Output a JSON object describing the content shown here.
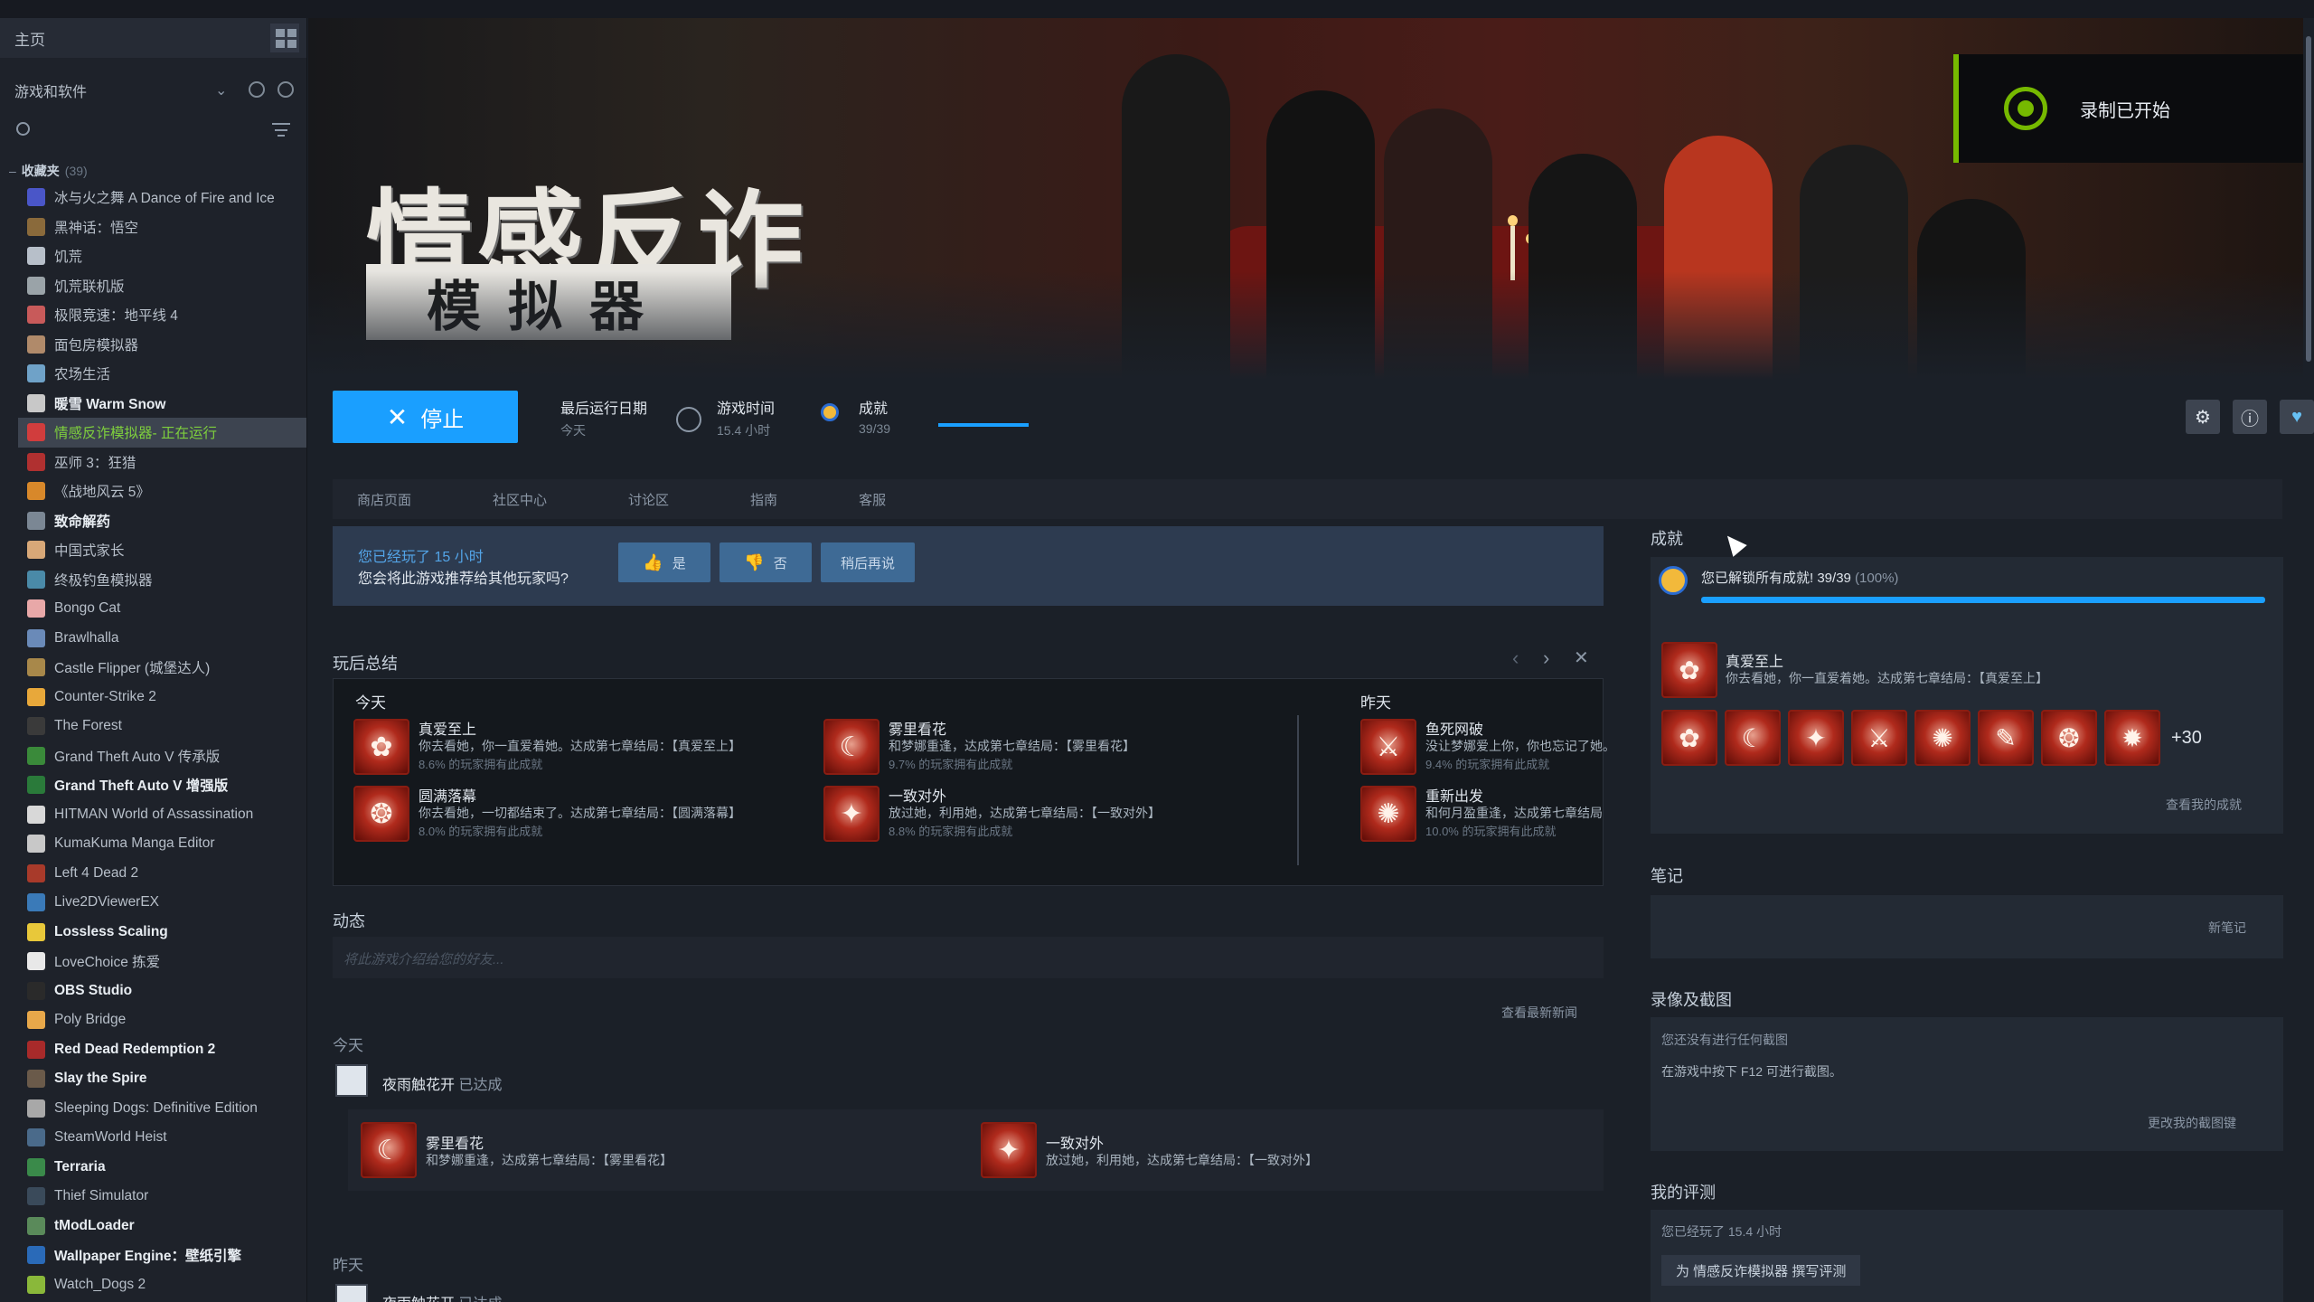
{
  "sidebar": {
    "home_label": "主页",
    "filter_label": "游戏和软件",
    "category_label": "收藏夹",
    "category_count": "(39)",
    "items": [
      {
        "label": "冰与火之舞 A Dance of Fire and Ice",
        "color": "#4a56c8",
        "bold": false
      },
      {
        "label": "黑神话：悟空",
        "color": "#8a6a3b",
        "bold": false
      },
      {
        "label": "饥荒",
        "color": "#b7bfc9",
        "bold": false
      },
      {
        "label": "饥荒联机版",
        "color": "#9aa3a8",
        "bold": false
      },
      {
        "label": "极限竞速：地平线 4",
        "color": "#c85a5a",
        "bold": false
      },
      {
        "label": "面包房模拟器",
        "color": "#b08a6a",
        "bold": false
      },
      {
        "label": "农场生活",
        "color": "#6fa2c8",
        "bold": false
      },
      {
        "label": "暖雪 Warm Snow",
        "color": "#c8c8c8",
        "bold": true
      },
      {
        "label": "情感反诈模拟器",
        "status": " - 正在运行",
        "color": "#d13d3d",
        "bold": false,
        "active": true
      },
      {
        "label": "巫师 3：狂猎",
        "color": "#b03030",
        "bold": false
      },
      {
        "label": "《战地风云 5》",
        "color": "#d8882a",
        "bold": false
      },
      {
        "label": "致命解药",
        "color": "#7b8794",
        "bold": true
      },
      {
        "label": "中国式家长",
        "color": "#d8a878",
        "bold": false
      },
      {
        "label": "终极钓鱼模拟器",
        "color": "#4a8aa8",
        "bold": false
      },
      {
        "label": "Bongo Cat",
        "color": "#e8a8a8",
        "bold": false
      },
      {
        "label": "Brawlhalla",
        "color": "#6a8ab8",
        "bold": false
      },
      {
        "label": "Castle Flipper (城堡达人)",
        "color": "#a8884a",
        "bold": false
      },
      {
        "label": "Counter-Strike 2",
        "color": "#e8a83a",
        "bold": false
      },
      {
        "label": "The Forest",
        "color": "#3a3a3a",
        "bold": false
      },
      {
        "label": "Grand Theft Auto V 传承版",
        "color": "#3a8a3a",
        "bold": false
      },
      {
        "label": "Grand Theft Auto V 增强版",
        "color": "#2a7a3a",
        "bold": true
      },
      {
        "label": "HITMAN World of Assassination",
        "color": "#d8d8d8",
        "bold": false
      },
      {
        "label": "KumaKuma Manga Editor",
        "color": "#c8c8c8",
        "bold": false
      },
      {
        "label": "Left 4 Dead 2",
        "color": "#a83a2a",
        "bold": false
      },
      {
        "label": "Live2DViewerEX",
        "color": "#3a7ab8",
        "bold": false
      },
      {
        "label": "Lossless Scaling",
        "color": "#e8c83a",
        "bold": true
      },
      {
        "label": "LoveChoice 拣爱",
        "color": "#e8e8e8",
        "bold": false
      },
      {
        "label": "OBS Studio",
        "color": "#2a2a2a",
        "bold": true
      },
      {
        "label": "Poly Bridge",
        "color": "#e8a84a",
        "bold": false
      },
      {
        "label": "Red Dead Redemption 2",
        "color": "#a82a2a",
        "bold": true
      },
      {
        "label": "Slay the Spire",
        "color": "#6a5a4a",
        "bold": true
      },
      {
        "label": "Sleeping Dogs: Definitive Edition",
        "color": "#a8a8a8",
        "bold": false
      },
      {
        "label": "SteamWorld Heist",
        "color": "#4a6a8a",
        "bold": false
      },
      {
        "label": "Terraria",
        "color": "#3a8a4a",
        "bold": true
      },
      {
        "label": "Thief Simulator",
        "color": "#3a4a5a",
        "bold": false
      },
      {
        "label": "tModLoader",
        "color": "#5a8a5a",
        "bold": true
      },
      {
        "label": "Wallpaper Engine：壁纸引擎",
        "color": "#2a6ab8",
        "bold": true
      },
      {
        "label": "Watch_Dogs 2",
        "color": "#8ab83a",
        "bold": false
      }
    ]
  },
  "hero": {
    "title": "情感反诈",
    "subtitle": "模拟器"
  },
  "toast": {
    "text": "录制已开始"
  },
  "actionbar": {
    "stop_label": "停止",
    "last_run_label": "最后运行日期",
    "last_run_value": "今天",
    "playtime_label": "游戏时间",
    "playtime_value": "15.4 小时",
    "achievements_label": "成就",
    "achievements_value": "39/39",
    "achievements_fraction": 1.0
  },
  "tabs": [
    "商店页面",
    "社区中心",
    "讨论区",
    "指南",
    "客服"
  ],
  "recommend": {
    "line1": "您已经玩了 15 小时",
    "line2": "您会将此游戏推荐给其他玩家吗?",
    "yes": "是",
    "no": "否",
    "later": "稍后再说"
  },
  "summary": {
    "title": "玩后总结",
    "today": "今天",
    "yesterday": "昨天",
    "today_items": [
      {
        "name": "真爱至上",
        "desc": "你去看她，你一直爱着她。达成第七章结局：【真爱至上】",
        "pct": "8.6% 的玩家拥有此成就"
      },
      {
        "name": "雾里看花",
        "desc": "和梦娜重逢，达成第七章结局：【雾里看花】",
        "pct": "9.7% 的玩家拥有此成就"
      },
      {
        "name": "圆满落幕",
        "desc": "你去看她，一切都结束了。达成第七章结局：【圆满落幕】",
        "pct": "8.0% 的玩家拥有此成就"
      },
      {
        "name": "一致对外",
        "desc": "放过她，利用她，达成第七章结局：【一致对外】",
        "pct": "8.8% 的玩家拥有此成就"
      }
    ],
    "yesterday_items": [
      {
        "name": "鱼死网破",
        "desc": "没让梦娜爱上你，你也忘记了她。",
        "pct": "9.4% 的玩家拥有此成就"
      },
      {
        "name": "重新出发",
        "desc": "和何月盈重逢，达成第七章结局",
        "pct": "10.0% 的玩家拥有此成就"
      }
    ]
  },
  "activity": {
    "title": "动态",
    "placeholder": "将此游戏介绍给您的好友...",
    "news_link": "查看最新新闻",
    "today": "今天",
    "yesterday": "昨天",
    "user": "夜雨触花开",
    "achieved": "已达成",
    "feed_items": [
      {
        "name": "雾里看花",
        "desc": "和梦娜重逢，达成第七章结局：【雾里看花】"
      },
      {
        "name": "一致对外",
        "desc": "放过她，利用她，达成第七章结局：【一致对外】"
      }
    ]
  },
  "right": {
    "achievements_title": "成就",
    "unlocked_text": "您已解锁所有成就! 39/39",
    "unlocked_pct": "(100%)",
    "feature_name": "真爱至上",
    "feature_desc": "你去看她，你一直爱着她。达成第七章结局：【真爱至上】",
    "more_count": "+30",
    "view_link": "查看我的成就",
    "notes_title": "笔记",
    "new_note": "新笔记",
    "screens_title": "录像及截图",
    "screens_line1": "您还没有进行任何截图",
    "screens_line2": "在游戏中按下 F12 可进行截图。",
    "screens_link": "更改我的截图键",
    "review_title": "我的评测",
    "review_played": "您已经玩了 15.4 小时",
    "review_button": "为 情感反诈模拟器 撰写评测"
  }
}
